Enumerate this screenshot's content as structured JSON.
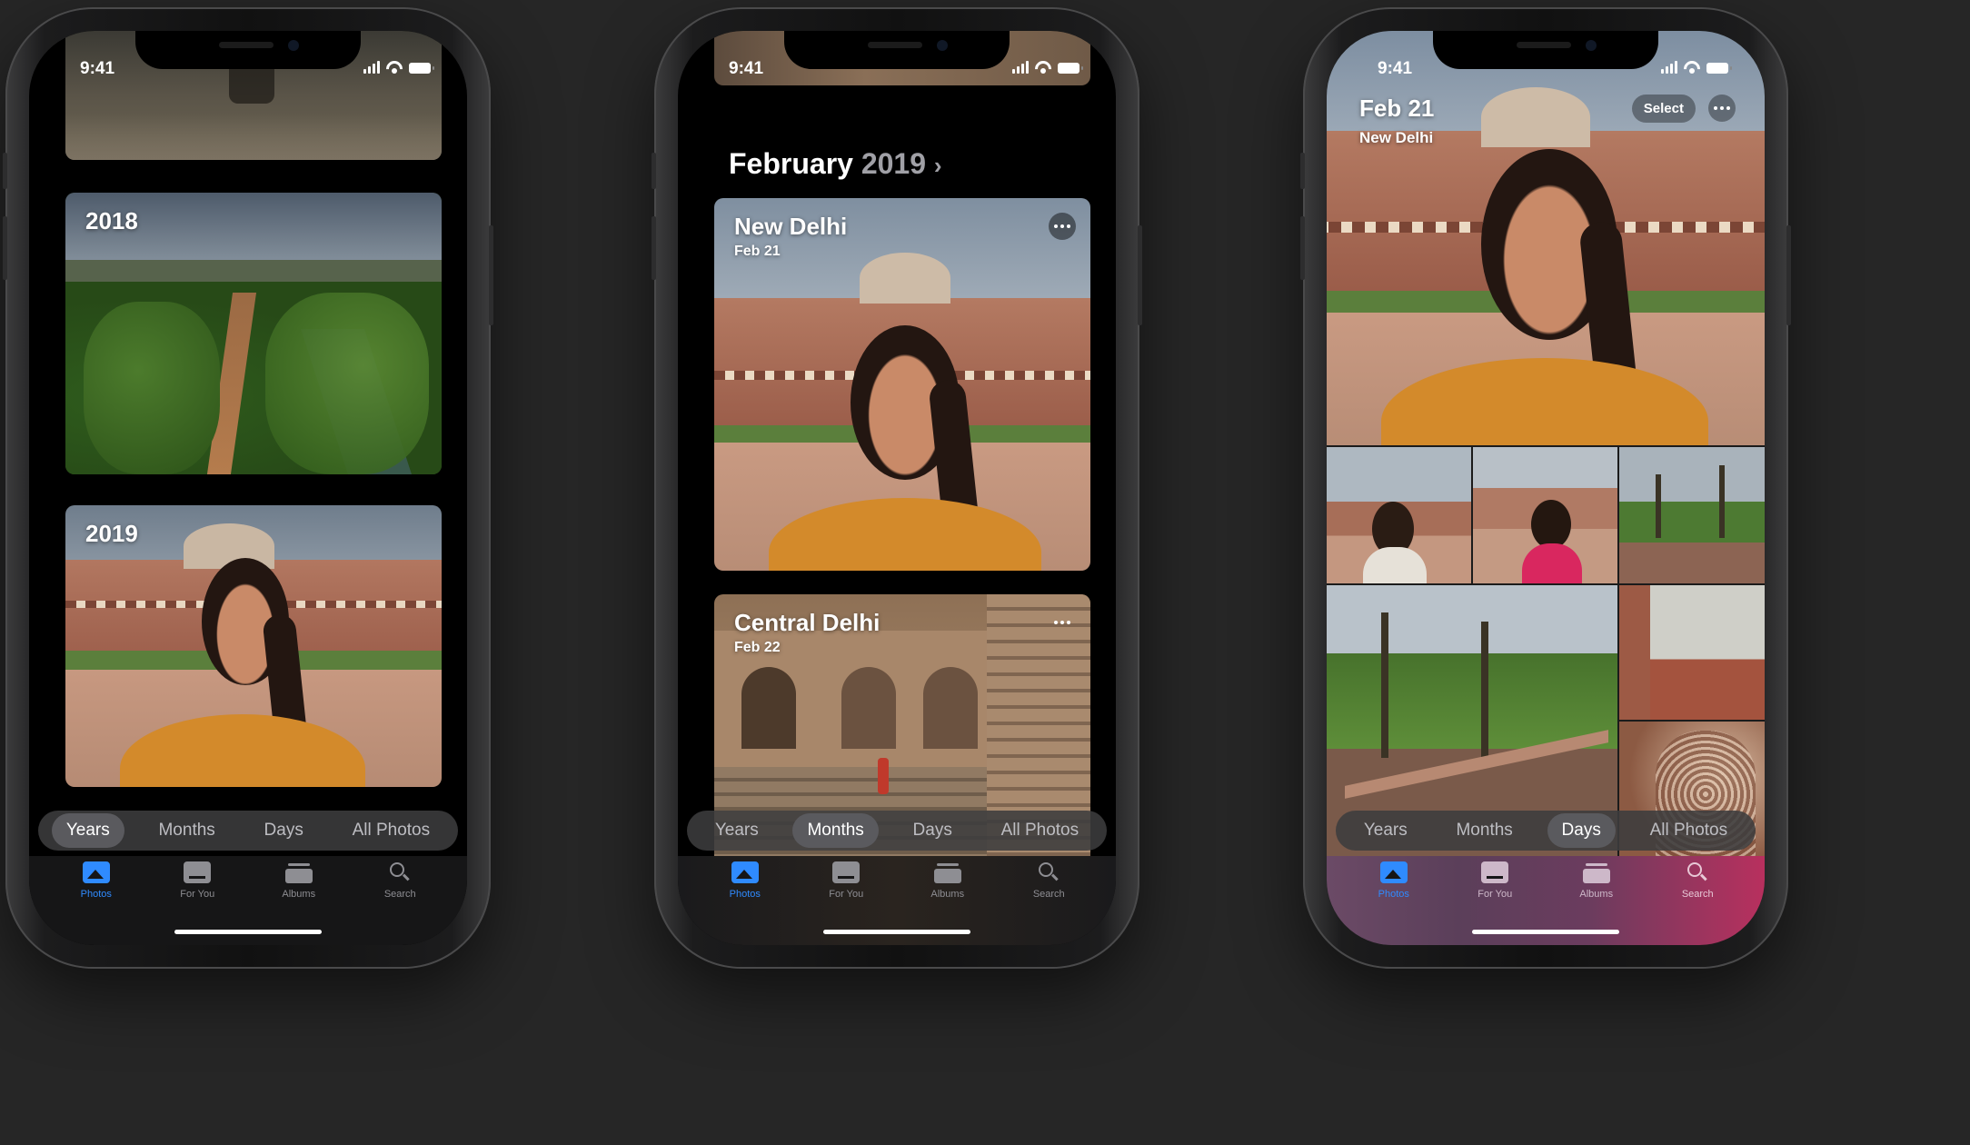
{
  "status": {
    "time": "9:41"
  },
  "tabs": [
    {
      "label": "Photos",
      "icon": "photos-icon"
    },
    {
      "label": "For You",
      "icon": "for-you-icon"
    },
    {
      "label": "Albums",
      "icon": "albums-icon"
    },
    {
      "label": "Search",
      "icon": "search-icon"
    }
  ],
  "segments": [
    "Years",
    "Months",
    "Days",
    "All Photos"
  ],
  "colors": {
    "accent": "#2f8bff",
    "background": "#262626"
  },
  "phone1": {
    "active_segment": "Years",
    "cards": [
      {
        "title": "2018"
      },
      {
        "title": "2019"
      }
    ]
  },
  "phone2": {
    "active_segment": "Months",
    "header": {
      "month": "February",
      "year": "2019"
    },
    "cards": [
      {
        "title": "New Delhi",
        "subtitle": "Feb 21"
      },
      {
        "title": "Central Delhi",
        "subtitle": "Feb 22"
      }
    ]
  },
  "phone3": {
    "active_segment": "Days",
    "title": "Feb 21",
    "subtitle": "New Delhi",
    "select_label": "Select"
  }
}
